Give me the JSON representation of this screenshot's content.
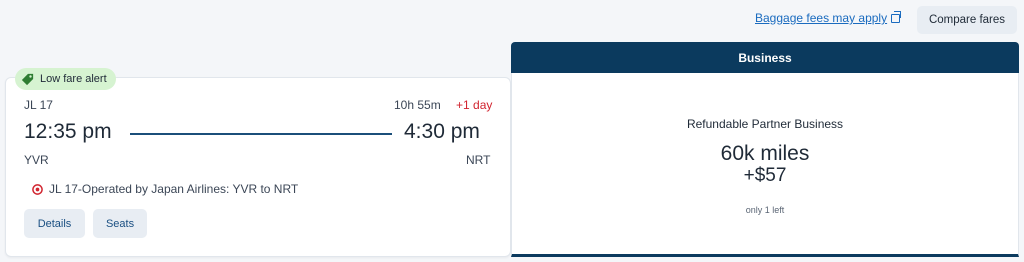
{
  "top_actions": {
    "baggage_link": "Baggage fees may apply",
    "compare_button": "Compare fares"
  },
  "alert": {
    "label": "Low fare alert",
    "color": "#d6f3d1",
    "icon": "tag-icon"
  },
  "flight": {
    "number": "JL 17",
    "duration": "10h 55m",
    "plus_day": "+1 day",
    "departure_time": "12:35 pm",
    "arrival_time": "4:30 pm",
    "departure_code": "YVR",
    "arrival_code": "NRT",
    "operated_by": "JL 17-Operated by Japan Airlines: YVR to NRT",
    "airline_icon": "jal-logo-icon",
    "details_button": "Details",
    "seats_button": "Seats"
  },
  "fare": {
    "cabin": "Business",
    "name": "Refundable Partner Business",
    "miles": "60k miles",
    "price": "+$57",
    "availability": "only 1 left",
    "header_color": "#0b3a5e"
  }
}
